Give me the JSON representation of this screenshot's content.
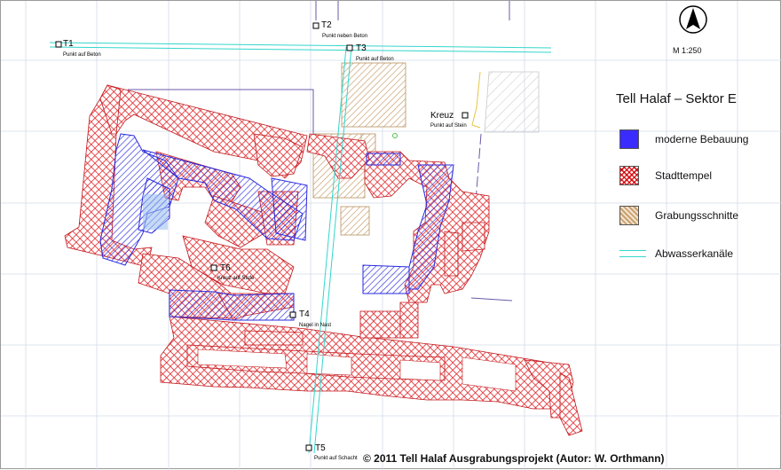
{
  "map": {
    "title": "Tell Halaf – Sektor E",
    "scale": "M 1:250",
    "north_arrow": "N",
    "copyright": "© 2011 Tell Halaf Ausgrabungsprojekt (Autor: W. Orthmann)"
  },
  "legend": [
    {
      "label": "moderne Bebauung",
      "color": "#3a2cff",
      "icon": "blue-fill-swatch"
    },
    {
      "label": "Stadttempel",
      "color": "#e0252a",
      "icon": "red-hatch-swatch"
    },
    {
      "label": "Grabungsschnitte",
      "color": "#c9a070",
      "icon": "tan-hatch-swatch"
    },
    {
      "label": "Abwasserkanäle",
      "color": "#33d6cc",
      "icon": "cyan-double-line"
    }
  ],
  "survey_points": [
    {
      "id": "T1",
      "note": "Punkt auf Beton"
    },
    {
      "id": "T2",
      "note": "Punkt neben Beton"
    },
    {
      "id": "T3",
      "note": "Punkt auf Beton"
    },
    {
      "id": "Kreuz",
      "note": "Punkt auf Stein"
    },
    {
      "id": "T6",
      "note": "Kreuz auf Stufe"
    },
    {
      "id": "T4",
      "note": "Nagel in Nast"
    },
    {
      "id": "T5",
      "note": "Punkt auf Schacht"
    }
  ],
  "colors": {
    "temple_red": "#e0252a",
    "modern_blue": "#2a2adf",
    "trench_tan": "#c9a070",
    "canal_cyan": "#33d6cc",
    "grid": "#cfd8e6"
  }
}
